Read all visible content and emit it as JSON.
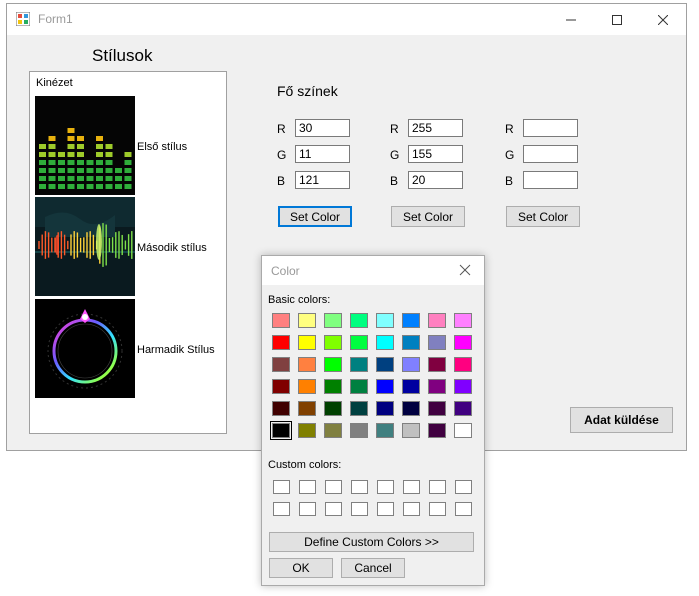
{
  "window": {
    "title": "Form1"
  },
  "styles_heading": "Stílusok",
  "style_list": {
    "header": "Kinézet",
    "items": [
      {
        "label": "Első stílus"
      },
      {
        "label": "Második stílus"
      },
      {
        "label": "Harmadik Stílus"
      }
    ]
  },
  "main_colors_heading": "Fő színek",
  "color_columns": [
    {
      "r_label": "R",
      "g_label": "G",
      "b_label": "B",
      "r": "30",
      "g": "11",
      "b": "121",
      "button": "Set Color"
    },
    {
      "r_label": "R",
      "g_label": "G",
      "b_label": "B",
      "r": "255",
      "g": "155",
      "b": "20",
      "button": "Set Color"
    },
    {
      "r_label": "R",
      "g_label": "G",
      "b_label": "B",
      "r": "",
      "g": "",
      "b": "",
      "button": "Set Color"
    }
  ],
  "send_button": "Adat küldése",
  "color_dialog": {
    "title": "Color",
    "basic_label": "Basic colors:",
    "custom_label": "Custom colors:",
    "define_button": "Define Custom Colors >>",
    "ok_button": "OK",
    "cancel_button": "Cancel",
    "basic_colors": [
      [
        "#ff8080",
        "#ffff80",
        "#80ff80",
        "#00ff80",
        "#80ffff",
        "#0080ff",
        "#ff80c0",
        "#ff80ff"
      ],
      [
        "#ff0000",
        "#ffff00",
        "#80ff00",
        "#00ff40",
        "#00ffff",
        "#0080c0",
        "#8080c0",
        "#ff00ff"
      ],
      [
        "#804040",
        "#ff8040",
        "#00ff00",
        "#008080",
        "#004080",
        "#8080ff",
        "#800040",
        "#ff0080"
      ],
      [
        "#800000",
        "#ff8000",
        "#008000",
        "#008040",
        "#0000ff",
        "#0000a0",
        "#800080",
        "#8000ff"
      ],
      [
        "#400000",
        "#804000",
        "#004000",
        "#004040",
        "#000080",
        "#000040",
        "#400040",
        "#400080"
      ],
      [
        "#000000",
        "#808000",
        "#808040",
        "#808080",
        "#408080",
        "#c0c0c0",
        "#400040",
        "#ffffff"
      ]
    ],
    "selected_color": "#000000"
  }
}
